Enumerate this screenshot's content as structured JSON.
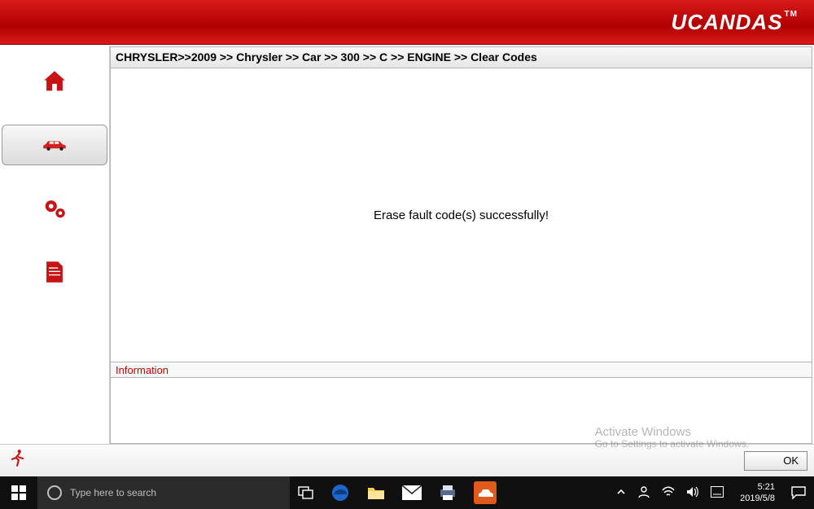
{
  "brand": "UCANDAS",
  "brand_suffix": "TM",
  "breadcrumb": "CHRYSLER>>2009 >> Chrysler >> Car >> 300 >> C >> ENGINE >> Clear Codes",
  "message": "Erase fault code(s) successfully!",
  "info_label": "Information",
  "ok_label": "OK",
  "watermark": {
    "line1": "Activate Windows",
    "line2": "Go to Settings to activate Windows."
  },
  "taskbar": {
    "search_placeholder": "Type here to search",
    "time": "5:21",
    "date": "2019/5/8"
  },
  "sidebar": {
    "items": [
      {
        "name": "home"
      },
      {
        "name": "vehicle"
      },
      {
        "name": "settings"
      },
      {
        "name": "report"
      }
    ]
  }
}
